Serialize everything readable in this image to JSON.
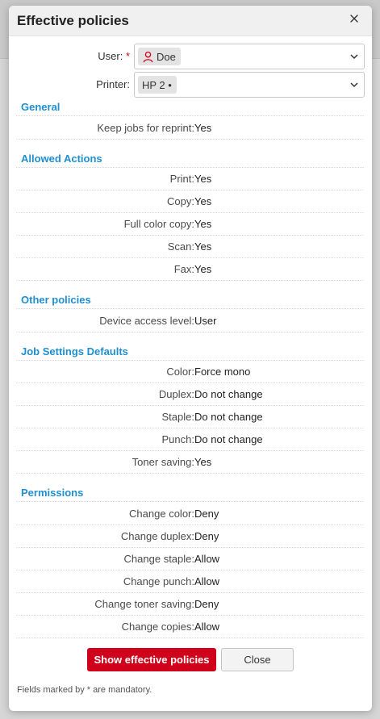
{
  "dialog": {
    "title": "Effective policies",
    "close_icon": "close-icon"
  },
  "form": {
    "user": {
      "label": "User:",
      "required_mark": "*",
      "value": "Doe",
      "icon": "user-icon"
    },
    "printer": {
      "label": "Printer:",
      "value": "HP 2 •"
    }
  },
  "sections": {
    "general": {
      "title": "General",
      "rows": [
        {
          "label": "Keep jobs for reprint:",
          "value": "Yes"
        }
      ]
    },
    "allowed_actions": {
      "title": "Allowed Actions",
      "rows": [
        {
          "label": "Print:",
          "value": "Yes"
        },
        {
          "label": "Copy:",
          "value": "Yes"
        },
        {
          "label": "Full color copy:",
          "value": "Yes"
        },
        {
          "label": "Scan:",
          "value": "Yes"
        },
        {
          "label": "Fax:",
          "value": "Yes"
        }
      ]
    },
    "other_policies": {
      "title": "Other policies",
      "rows": [
        {
          "label": "Device access level:",
          "value": "User"
        }
      ]
    },
    "job_settings_defaults": {
      "title": "Job Settings Defaults",
      "rows": [
        {
          "label": "Color:",
          "value": "Force mono"
        },
        {
          "label": "Duplex:",
          "value": "Do not change"
        },
        {
          "label": "Staple:",
          "value": "Do not change"
        },
        {
          "label": "Punch:",
          "value": "Do not change"
        },
        {
          "label": "Toner saving:",
          "value": "Yes"
        }
      ]
    },
    "permissions": {
      "title": "Permissions",
      "rows": [
        {
          "label": "Change color:",
          "value": "Deny"
        },
        {
          "label": "Change duplex:",
          "value": "Deny"
        },
        {
          "label": "Change staple:",
          "value": "Allow"
        },
        {
          "label": "Change punch:",
          "value": "Allow"
        },
        {
          "label": "Change toner saving:",
          "value": "Deny"
        },
        {
          "label": "Change copies:",
          "value": "Allow"
        }
      ]
    }
  },
  "buttons": {
    "show_label": "Show effective policies",
    "close_label": "Close"
  },
  "footnote": "Fields marked by * are mandatory.",
  "colors": {
    "accent_red": "#d0021b",
    "section_blue": "#1f8fcf"
  }
}
